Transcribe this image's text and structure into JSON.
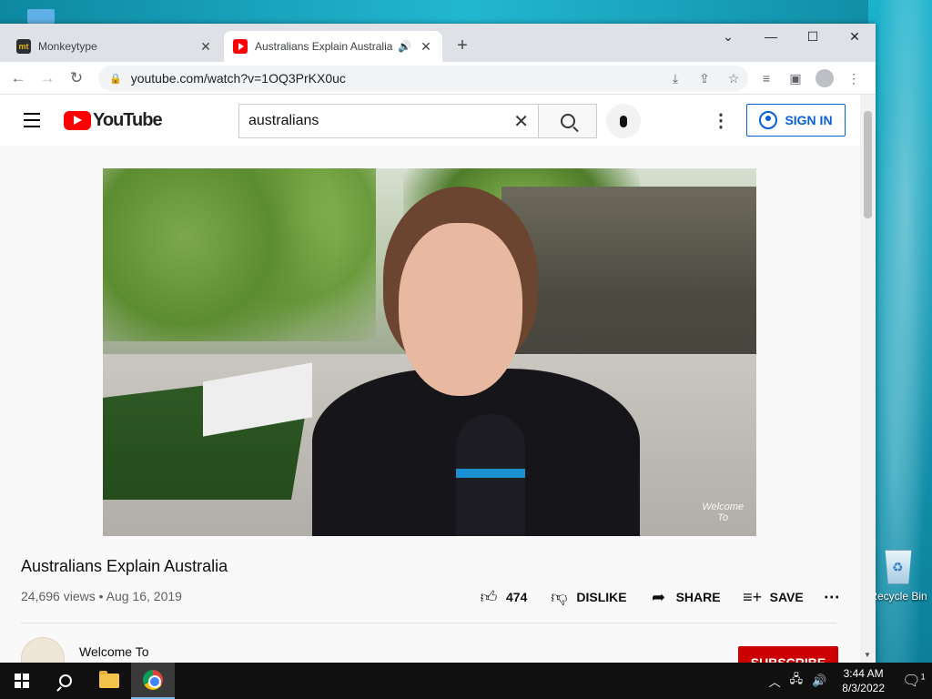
{
  "desktop": {
    "recycle_bin_label": "Recycle Bin"
  },
  "browser": {
    "tabs": [
      {
        "title": "Monkeytype",
        "favicon": "mt"
      },
      {
        "title": "Australians Explain Australia",
        "favicon": "youtube"
      }
    ],
    "url": "youtube.com/watch?v=1OQ3PrKX0uc"
  },
  "youtube": {
    "logo_text": "YouTube",
    "search_query": "australians",
    "sign_in_label": "SIGN IN",
    "video": {
      "watermark_line1": "Welcome",
      "watermark_line2": "To"
    },
    "title": "Australians Explain Australia",
    "meta": "24,696 views • Aug 16, 2019",
    "actions": {
      "like_count": "474",
      "dislike_label": "DISLIKE",
      "share_label": "SHARE",
      "save_label": "SAVE"
    },
    "channel_name": "Welcome To",
    "subscribe_label": "SUBSCRIBE"
  },
  "taskbar": {
    "time": "3:44 AM",
    "date": "8/3/2022",
    "notification_count": "1"
  }
}
